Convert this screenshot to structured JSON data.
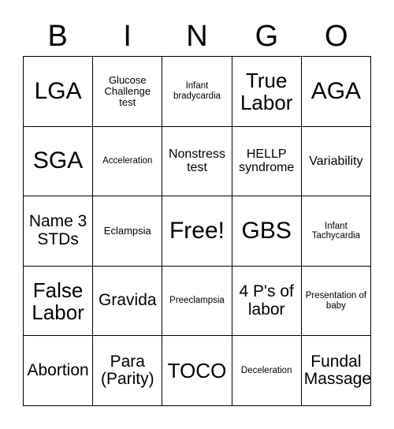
{
  "card": {
    "header_letters": [
      "B",
      "I",
      "N",
      "G",
      "O"
    ],
    "rows": [
      [
        {
          "text": "LGA",
          "size": "fs-xl"
        },
        {
          "text": "Glucose Challenge test",
          "size": "fs-xs"
        },
        {
          "text": "Infant bradycardia",
          "size": "fs-xxs"
        },
        {
          "text": "True Labor",
          "size": "fs-lg"
        },
        {
          "text": "AGA",
          "size": "fs-xl"
        }
      ],
      [
        {
          "text": "SGA",
          "size": "fs-xl"
        },
        {
          "text": "Acceleration",
          "size": "fs-xxs"
        },
        {
          "text": "Nonstress test",
          "size": "fs-sm"
        },
        {
          "text": "HELLP syndrome",
          "size": "fs-sm"
        },
        {
          "text": "Variability",
          "size": "fs-sm"
        }
      ],
      [
        {
          "text": "Name 3 STDs",
          "size": "fs-md"
        },
        {
          "text": "Eclampsia",
          "size": "fs-xs"
        },
        {
          "text": "Free!",
          "size": "fs-xl"
        },
        {
          "text": "GBS",
          "size": "fs-xl"
        },
        {
          "text": "Infant Tachycardia",
          "size": "fs-xxs"
        }
      ],
      [
        {
          "text": "False Labor",
          "size": "fs-lg"
        },
        {
          "text": "Gravida",
          "size": "fs-md"
        },
        {
          "text": "Preeclampsia",
          "size": "fs-xxs"
        },
        {
          "text": "4 P's of labor",
          "size": "fs-md"
        },
        {
          "text": "Presentation of baby",
          "size": "fs-xxs"
        }
      ],
      [
        {
          "text": "Abortion",
          "size": "fs-md"
        },
        {
          "text": "Para (Parity)",
          "size": "fs-md"
        },
        {
          "text": "TOCO",
          "size": "fs-lg"
        },
        {
          "text": "Deceleration",
          "size": "fs-xxs"
        },
        {
          "text": "Fundal Massage",
          "size": "fs-md"
        }
      ]
    ]
  }
}
